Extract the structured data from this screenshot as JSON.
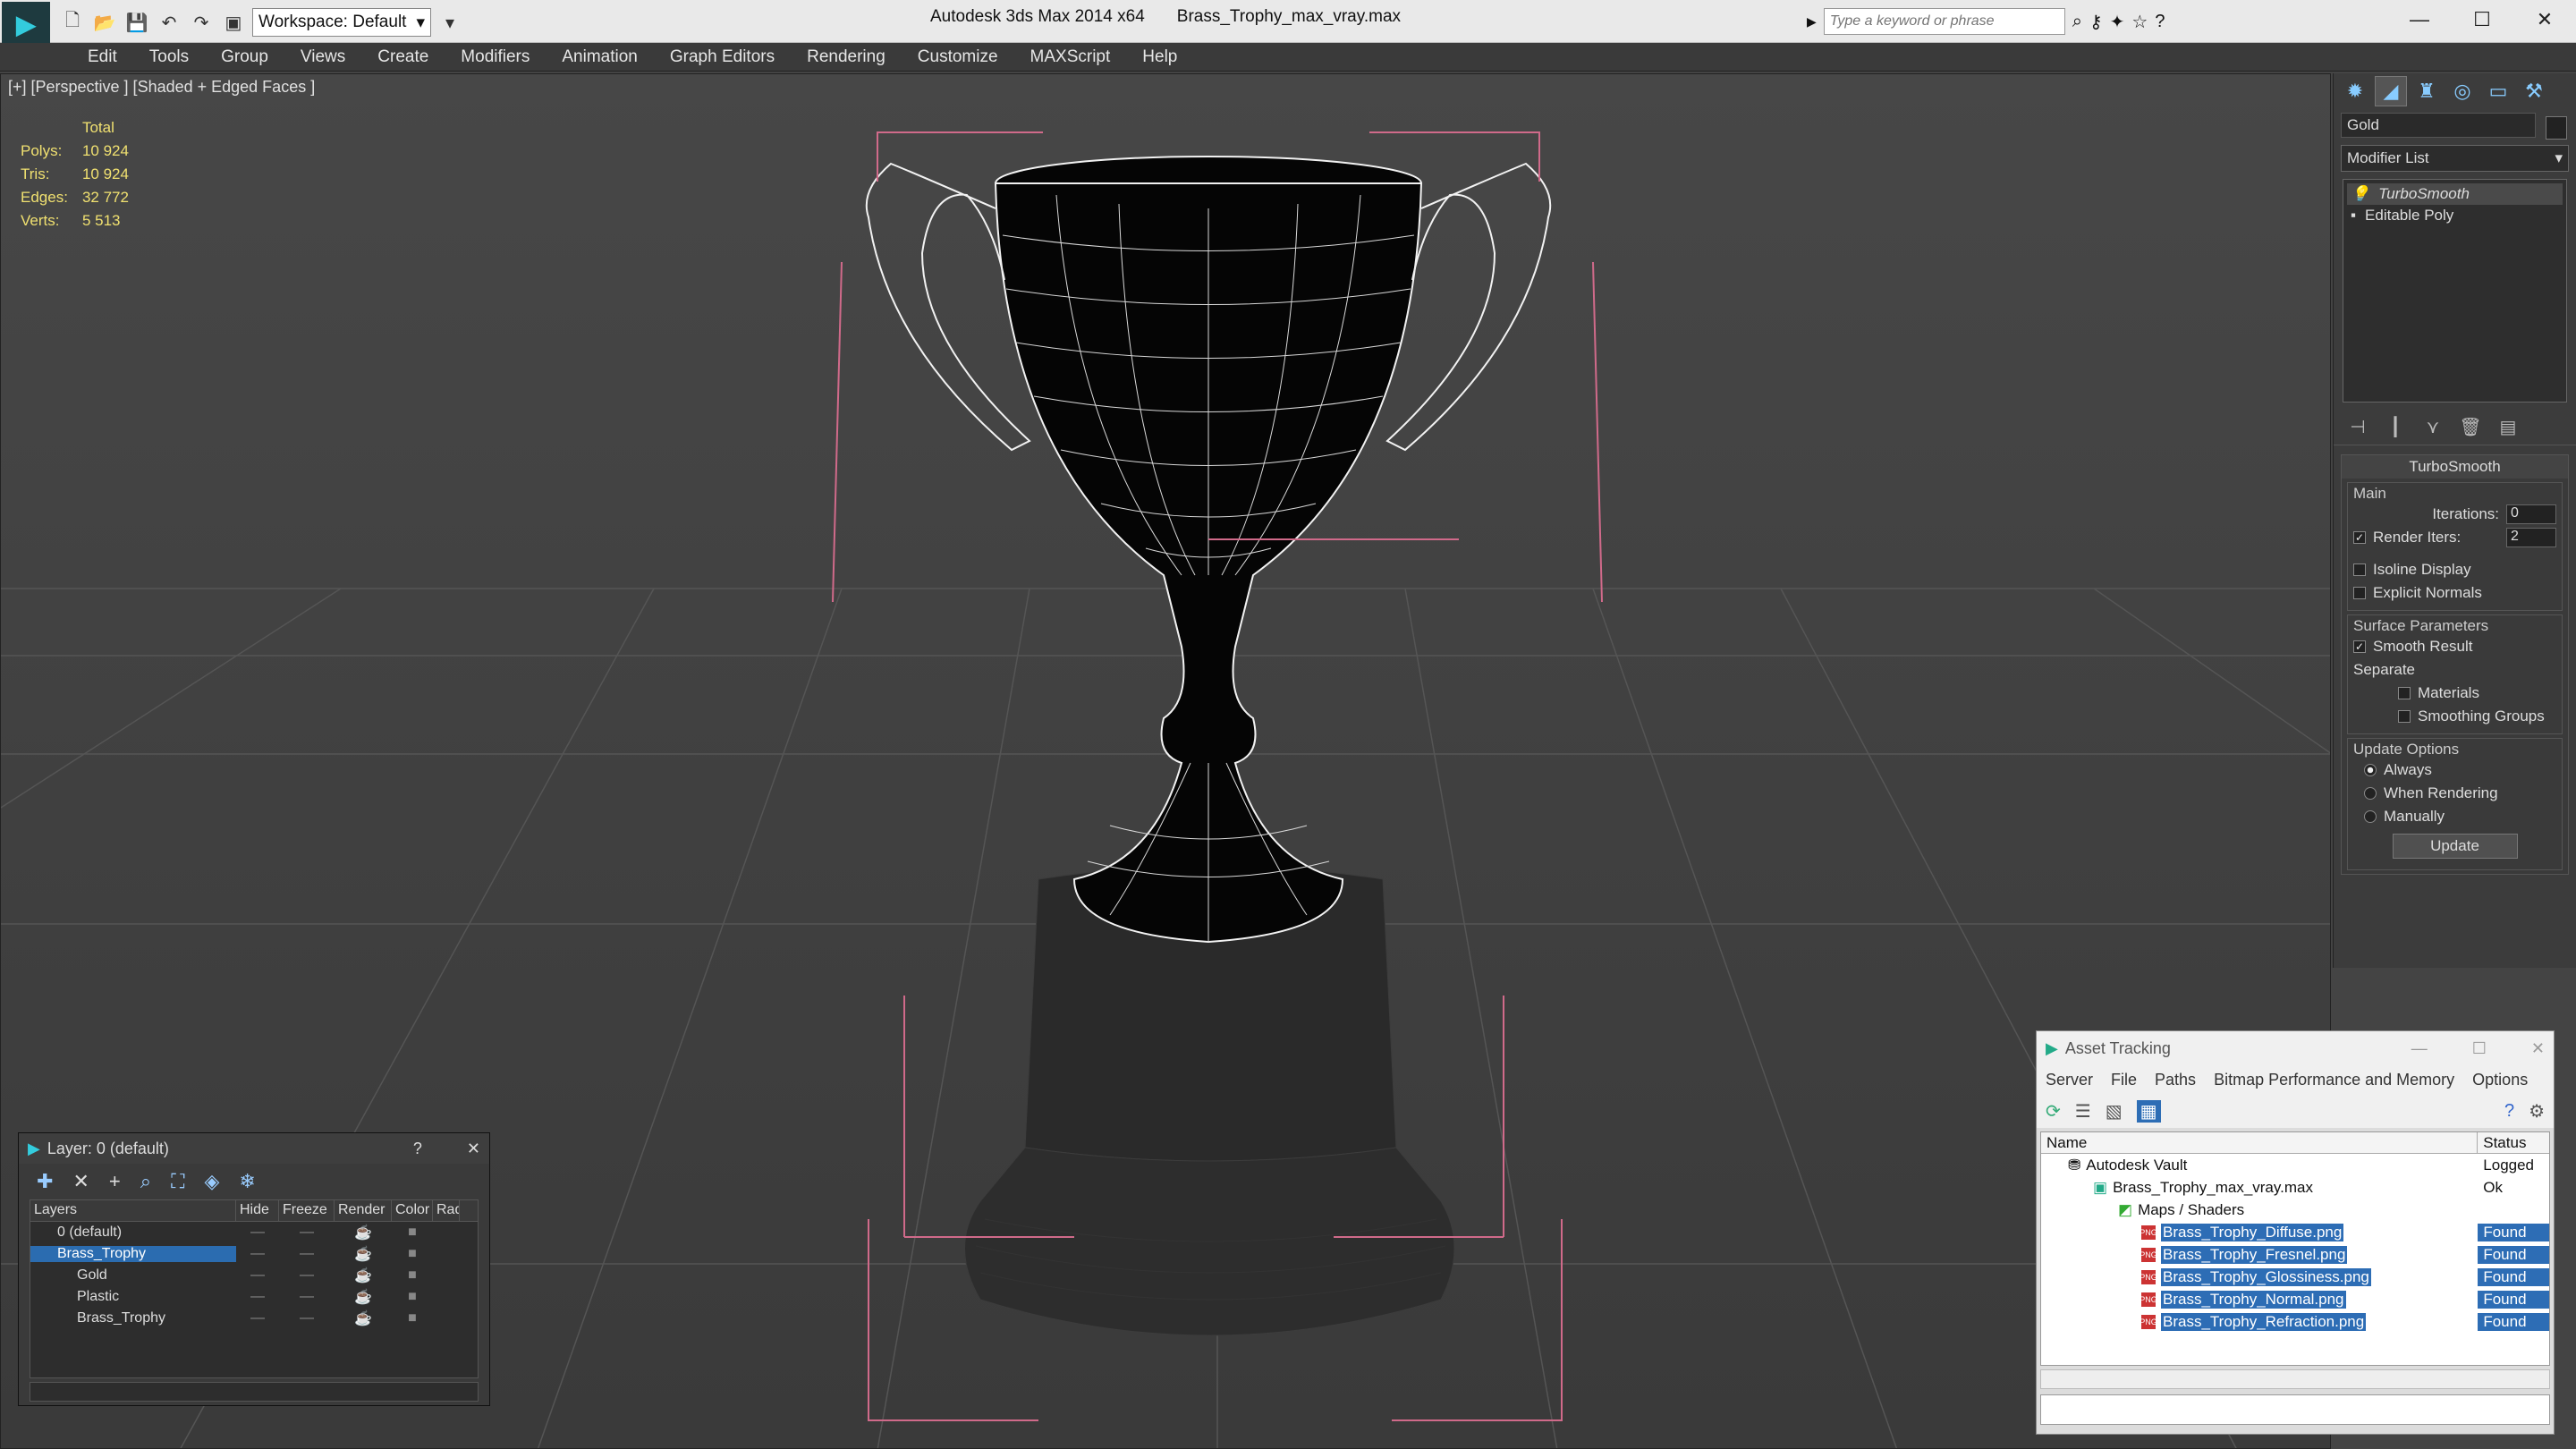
{
  "app": {
    "title": "Autodesk 3ds Max  2014 x64",
    "file": "Brass_Trophy_max_vray.max",
    "workspace": "Workspace: Default",
    "search_placeholder": "Type a keyword or phrase"
  },
  "menu": [
    "Edit",
    "Tools",
    "Group",
    "Views",
    "Create",
    "Modifiers",
    "Animation",
    "Graph Editors",
    "Rendering",
    "Customize",
    "MAXScript",
    "Help"
  ],
  "viewport": {
    "label": "[+] [Perspective ] [Shaded + Edged Faces ]",
    "stats_header": "Total",
    "stats": [
      {
        "k": "Polys:",
        "v": "10 924"
      },
      {
        "k": "Tris:",
        "v": "10 924"
      },
      {
        "k": "Edges:",
        "v": "32 772"
      },
      {
        "k": "Verts:",
        "v": "5 513"
      }
    ]
  },
  "command_panel": {
    "object_name": "Gold",
    "modifier_list": "Modifier List",
    "stack": [
      "TurboSmooth",
      "Editable Poly"
    ],
    "rollout_title": "TurboSmooth",
    "main_group": "Main",
    "iterations_label": "Iterations:",
    "iterations": "0",
    "render_iters_label": "Render Iters:",
    "render_iters": "2",
    "isoline": "Isoline Display",
    "explicit_normals": "Explicit Normals",
    "surface_group": "Surface Parameters",
    "smooth_result": "Smooth Result",
    "separate": "Separate",
    "materials": "Materials",
    "smoothing_groups": "Smoothing Groups",
    "update_group": "Update Options",
    "always": "Always",
    "when_rendering": "When Rendering",
    "manually": "Manually",
    "update_btn": "Update"
  },
  "layer_window": {
    "title": "Layer: 0 (default)",
    "help": "?",
    "columns": [
      "Layers",
      "Hide",
      "Freeze",
      "Render",
      "Color",
      "Rad"
    ],
    "rows": [
      "0 (default)",
      "Brass_Trophy",
      "Gold",
      "Plastic",
      "Brass_Trophy"
    ]
  },
  "asset_window": {
    "title": "Asset Tracking",
    "menu": [
      "Server",
      "File",
      "Paths",
      "Bitmap Performance and Memory",
      "Options"
    ],
    "columns": [
      "Name",
      "Status"
    ],
    "rows": [
      {
        "name": "Autodesk Vault",
        "status": "Logged"
      },
      {
        "name": "Brass_Trophy_max_vray.max",
        "status": "Ok"
      },
      {
        "name": "Maps / Shaders",
        "status": ""
      },
      {
        "name": "Brass_Trophy_Diffuse.png",
        "status": "Found"
      },
      {
        "name": "Brass_Trophy_Fresnel.png",
        "status": "Found"
      },
      {
        "name": "Brass_Trophy_Glossiness.png",
        "status": "Found"
      },
      {
        "name": "Brass_Trophy_Normal.png",
        "status": "Found"
      },
      {
        "name": "Brass_Trophy_Refraction.png",
        "status": "Found"
      }
    ]
  }
}
